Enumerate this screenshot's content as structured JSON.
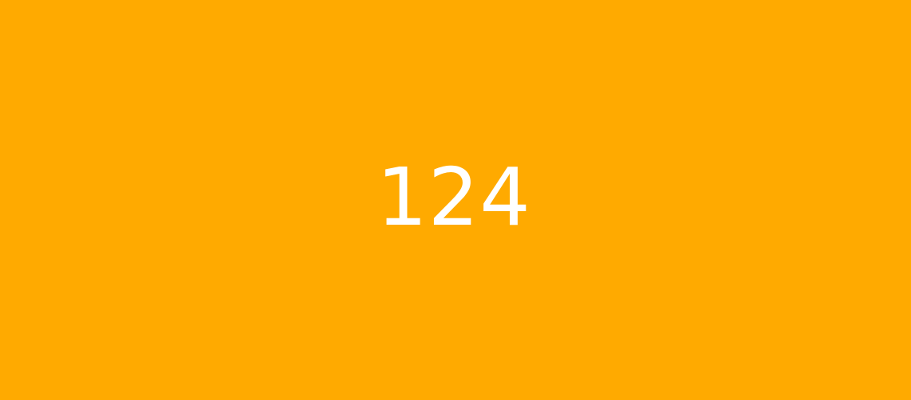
{
  "tile": {
    "value": "124",
    "background_color": "#FFAA00",
    "text_color": "#FFFFFF"
  }
}
